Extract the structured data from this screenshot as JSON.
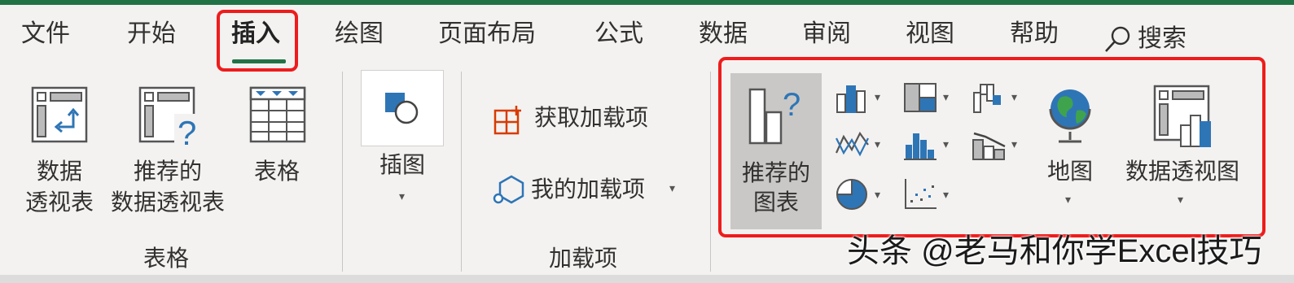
{
  "tabs": [
    "文件",
    "开始",
    "插入",
    "绘图",
    "页面布局",
    "公式",
    "数据",
    "审阅",
    "视图",
    "帮助"
  ],
  "search_label": "搜索",
  "groups": {
    "tables": {
      "label": "表格",
      "pivot_line1": "数据",
      "pivot_line2": "透视表",
      "rec_pivot_line1": "推荐的",
      "rec_pivot_line2": "数据透视表",
      "table": "表格"
    },
    "illustrations": {
      "label": "插图"
    },
    "addins": {
      "label": "加载项",
      "get_addins": "获取加载项",
      "my_addins": "我的加载项"
    },
    "charts": {
      "rec_line1": "推荐的",
      "rec_line2": "图表",
      "maps": "地图",
      "pivot_chart": "数据透视图"
    }
  },
  "watermark": "头条 @老马和你学Excel技巧",
  "colors": {
    "accent": "#217346",
    "highlight_box": "#ee1c1c",
    "icon_blue": "#2e75b6"
  }
}
